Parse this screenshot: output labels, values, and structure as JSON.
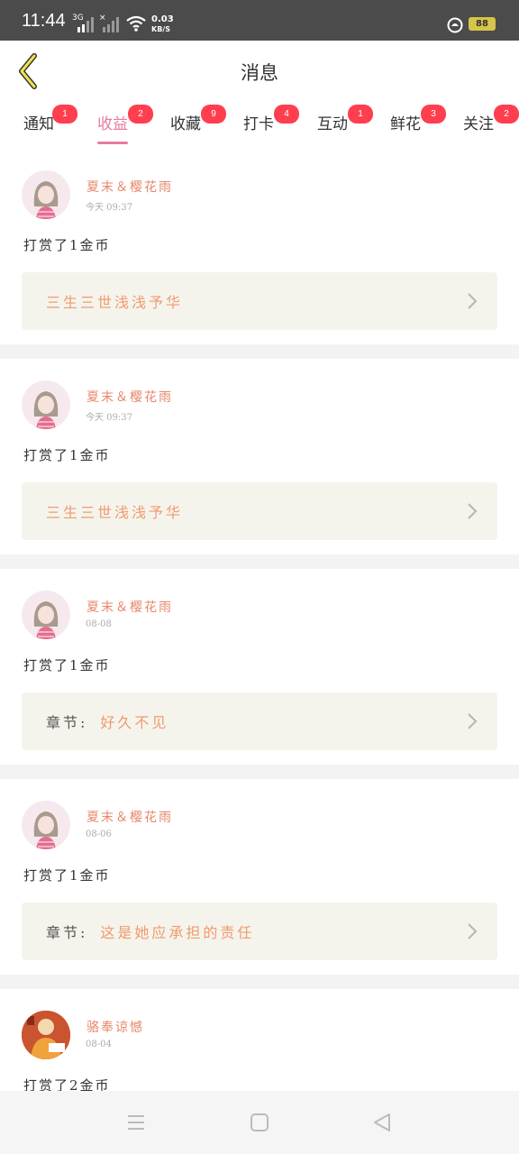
{
  "status": {
    "time": "11:44",
    "sig1": "3G",
    "sig2": "×",
    "net_speed": "0.03",
    "net_unit": "KB/S",
    "battery": "88"
  },
  "header": {
    "title": "消息",
    "back_icon": "chevron-left-icon"
  },
  "tabs": [
    {
      "label": "通知",
      "badge": "1"
    },
    {
      "label": "收益",
      "badge": "2",
      "active": true
    },
    {
      "label": "收藏",
      "badge": "9"
    },
    {
      "label": "打卡",
      "badge": "4"
    },
    {
      "label": "互动",
      "badge": "1"
    },
    {
      "label": "鲜花",
      "badge": "3"
    },
    {
      "label": "关注",
      "badge": "2"
    }
  ],
  "feed": [
    {
      "user": "夏末＆樱花雨",
      "meta": "今天 09:37",
      "message": "打赏了1金币",
      "ref_label": "",
      "ref_text": "三生三世浅浅予华"
    },
    {
      "user": "夏末＆樱花雨",
      "meta": "今天 09:37",
      "message": "打赏了1金币",
      "ref_label": "",
      "ref_text": "三生三世浅浅予华"
    },
    {
      "user": "夏末＆樱花雨",
      "meta": "08-08",
      "message": "打赏了1金币",
      "ref_label": "章节:",
      "ref_text": "好久不见"
    },
    {
      "user": "夏末＆樱花雨",
      "meta": "08-06",
      "message": "打赏了1金币",
      "ref_label": "章节:",
      "ref_text": "这是她应承担的责任"
    },
    {
      "user": "骆奉谅憾",
      "meta": "08-04",
      "message": "打赏了2金币",
      "ref_label": "",
      "ref_text": ""
    }
  ],
  "colors": {
    "accent": "#e87aa4",
    "name": "#e8866a",
    "ref_bg": "#f5f4ec",
    "badge": "#ff3e4f"
  }
}
